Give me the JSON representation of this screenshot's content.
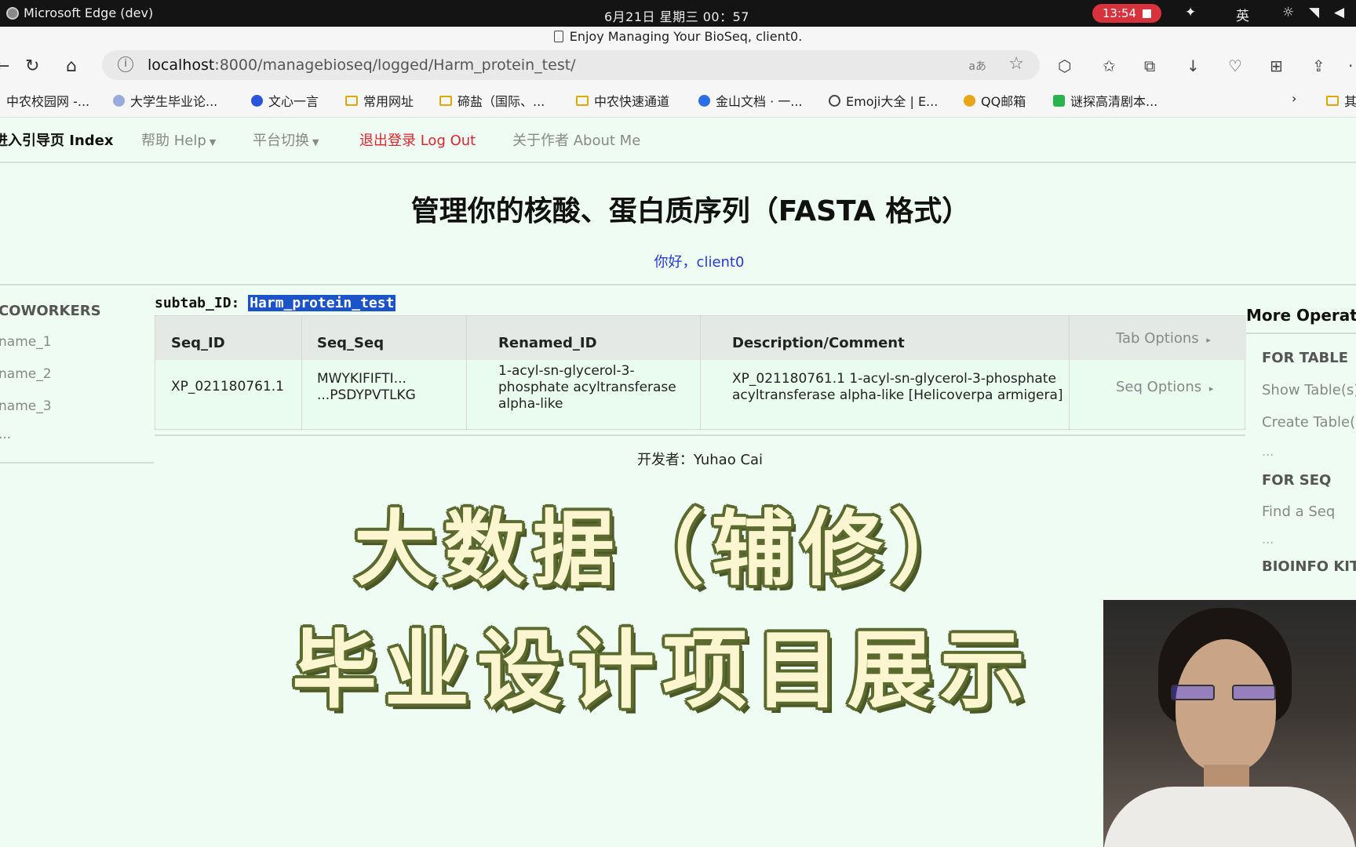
{
  "os_bar": {
    "app_name": "Microsoft Edge (dev)",
    "clock": "6月21日 星期三  00：57",
    "record_time": "13:54",
    "input_method": "英"
  },
  "browser": {
    "tab_title": "Enjoy Managing Your BioSeq, client0.",
    "url_host": "localhost",
    "url_rest": ":8000/managebioseq/logged/Harm_protein_test/",
    "read_aloud": "aあ",
    "bookmarks": [
      "中农校园网 -...",
      "大学生毕业论...",
      "文心一言",
      "常用网址",
      "碲盐（国际、...",
      "中农快速通道",
      "金山文档 · 一...",
      "Emoji大全 | E...",
      "QQ邮箱",
      "谜探高清剧本...",
      "其"
    ]
  },
  "nav": {
    "index": "进入引导页 Index",
    "help": "帮助 Help",
    "platform_switch": "平台切换",
    "logout": "退出登录 Log Out",
    "about": "关于作者 About Me"
  },
  "page": {
    "heading": "管理你的核酸、蛋白质序列（FASTA 格式）",
    "greeting": "你好，client0",
    "subtab_label": "subtab_ID:",
    "subtab_value": "Harm_protein_test",
    "footer": "开发者：Yuhao Cai"
  },
  "sidebar": {
    "heading": "COWORKERS",
    "items": [
      "name_1",
      "name_2",
      "name_3",
      "..."
    ]
  },
  "table": {
    "headers": [
      "Seq_ID",
      "Seq_Seq",
      "Renamed_ID",
      "Description/Comment",
      "Tab Options"
    ],
    "rows": [
      {
        "seq_id": "XP_021180761.1",
        "seq_seq_1": "MWYKIFIFTI...",
        "seq_seq_2": "...PSDYPVTLKG",
        "renamed_1": "1-acyl-sn-glycerol-3-",
        "renamed_2": "phosphate acyltransferase",
        "renamed_3": "alpha-like",
        "desc_1": "XP_021180761.1 1-acyl-sn-glycerol-3-phosphate",
        "desc_2": "acyltransferase alpha-like [Helicoverpa armigera]",
        "options": "Seq Options"
      }
    ]
  },
  "right_panel": {
    "title": "More Operations",
    "for_table": "FOR TABLE",
    "show_tables": "Show Table(s)",
    "create_tables": "Create Table(s)",
    "dots1": "...",
    "for_seq": "FOR SEQ",
    "find_seq": "Find a Seq",
    "dots2": "...",
    "bioinfo_kit": "BIOINFO KIT"
  },
  "overlay": {
    "line1": "大数据（辅修）",
    "line2": "毕业设计项目展示"
  },
  "colors": {
    "page_bg": "#eefcf3",
    "logout_red": "#e0242e",
    "greeting_blue": "#2438d6",
    "highlight_blue": "#1b53c9",
    "record_red": "#d8323c"
  }
}
